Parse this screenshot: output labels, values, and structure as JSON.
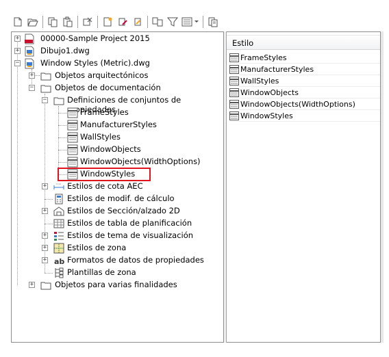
{
  "toolbar": {
    "buttons": [
      "new-icon",
      "open-icon",
      "copy-icon",
      "paste-icon",
      "purge-icon",
      "new-style-icon",
      "edit-style-icon",
      "set-from-icon",
      "synchronize-icon",
      "filter-icon",
      "view-icon",
      "window-icon"
    ]
  },
  "tree": {
    "items": [
      {
        "label": "00000-Sample Project 2015",
        "icon": "project-file-icon"
      },
      {
        "label": "Dibujo1.dwg",
        "icon": "drawing-icon"
      },
      {
        "label": "Window Styles (Metric).dwg",
        "icon": "drawing-icon"
      },
      {
        "label": "Objetos arquitectónicos",
        "icon": "folder-icon"
      },
      {
        "label": "Objetos de documentación",
        "icon": "folder-icon"
      },
      {
        "label": "Definiciones de conjuntos de propiedades",
        "icon": "folder-icon"
      },
      {
        "label": "FrameStyles",
        "icon": "property-set-icon"
      },
      {
        "label": "ManufacturerStyles",
        "icon": "property-set-icon"
      },
      {
        "label": "WallStyles",
        "icon": "property-set-icon"
      },
      {
        "label": "WindowObjects",
        "icon": "property-set-icon"
      },
      {
        "label": "WindowObjects(WidthOptions)",
        "icon": "property-set-icon"
      },
      {
        "label": "WindowStyles",
        "icon": "property-set-icon"
      },
      {
        "label": "Estilos de cota AEC",
        "icon": "dimension-icon"
      },
      {
        "label": "Estilos de modif. de cálculo",
        "icon": "calculator-icon"
      },
      {
        "label": "Estilos de Sección/alzado 2D",
        "icon": "section-icon"
      },
      {
        "label": "Estilos de tabla de planificación",
        "icon": "table-icon"
      },
      {
        "label": "Estilos de tema de visualización",
        "icon": "display-theme-icon"
      },
      {
        "label": "Estilos de zona",
        "icon": "zone-icon"
      },
      {
        "label": "Formatos de datos de propiedades",
        "icon": "data-format-icon"
      },
      {
        "label": "Plantillas de zona",
        "icon": "zone-template-icon"
      },
      {
        "label": "Objetos para varias finalidades",
        "icon": "folder-icon"
      }
    ]
  },
  "list": {
    "column_header": "Estilo",
    "rows": [
      "FrameStyles",
      "ManufacturerStyles",
      "WallStyles",
      "WindowObjects",
      "WindowObjects(WidthOptions)",
      "WindowStyles"
    ]
  },
  "colors": {
    "highlight_border": "#e0141e",
    "pane_border": "#8c8c8c"
  }
}
